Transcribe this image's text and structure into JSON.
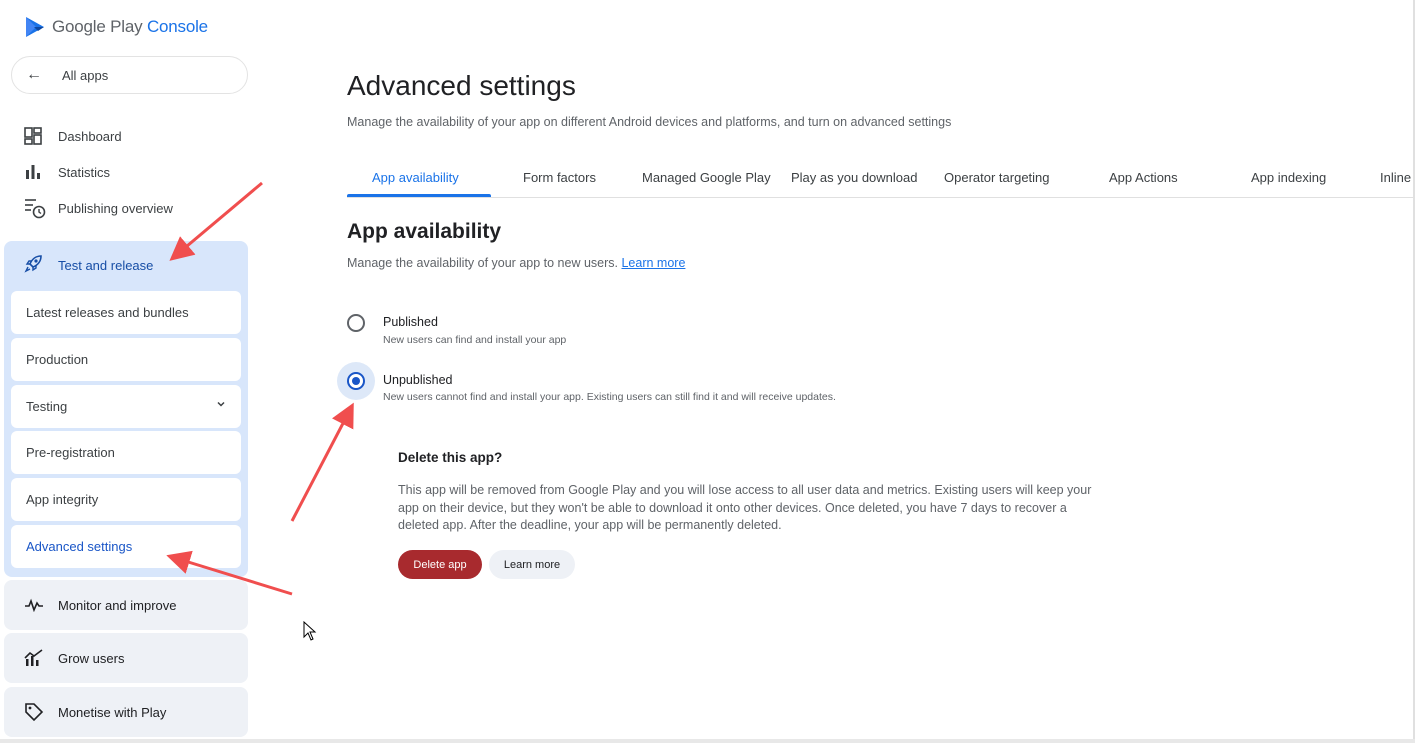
{
  "brand": {
    "name": "Google Play",
    "product": "Console",
    "accent": "#1a73e8"
  },
  "sidebar": {
    "all_apps": "All apps",
    "items": [
      {
        "label": "Dashboard",
        "icon": "dashboard-icon"
      },
      {
        "label": "Statistics",
        "icon": "bar-chart-icon"
      },
      {
        "label": "Publishing overview",
        "icon": "publishing-clock-icon"
      }
    ],
    "test_release": {
      "label": "Test and release",
      "icon": "rocket-icon",
      "sub_items": [
        {
          "label": "Latest releases and bundles"
        },
        {
          "label": "Production"
        },
        {
          "label": "Testing"
        },
        {
          "label": "Pre-registration"
        },
        {
          "label": "App integrity"
        },
        {
          "label": "Advanced settings",
          "active": true
        }
      ]
    },
    "groups": [
      {
        "label": "Monitor and improve",
        "icon": "pulse-icon"
      },
      {
        "label": "Grow users",
        "icon": "growth-chart-icon"
      },
      {
        "label": "Monetise with Play",
        "icon": "tag-icon"
      }
    ]
  },
  "main": {
    "title": "Advanced settings",
    "subtitle": "Manage the availability of your app on different Android devices and platforms, and turn on advanced settings",
    "tabs": [
      {
        "label": "App availability",
        "active": true
      },
      {
        "label": "Form factors"
      },
      {
        "label": "Managed Google Play"
      },
      {
        "label": "Play as you download"
      },
      {
        "label": "Operator targeting"
      },
      {
        "label": "App Actions"
      },
      {
        "label": "App indexing"
      },
      {
        "label": "Inline"
      }
    ],
    "section": {
      "title": "App availability",
      "subtitle": "Manage the availability of your app to new users.",
      "learn_more": "Learn more",
      "options": [
        {
          "label": "Published",
          "desc": "New users can find and install your app",
          "checked": false
        },
        {
          "label": "Unpublished",
          "desc": "New users cannot find and install your app. Existing users can still find it and will receive updates.",
          "checked": true
        }
      ]
    },
    "delete": {
      "title": "Delete this app?",
      "body": "This app will be removed from Google Play and you will lose access to all user data and metrics. Existing users will keep your app on their device, but they won't be able to download it onto other devices. Once deleted, you have 7 days to recover a deleted app. After the deadline, your app will be permanently deleted.",
      "delete_button": "Delete app",
      "learn_more_button": "Learn more",
      "danger_color": "#a82a2e"
    }
  },
  "annotation_color": "#f04e4e"
}
